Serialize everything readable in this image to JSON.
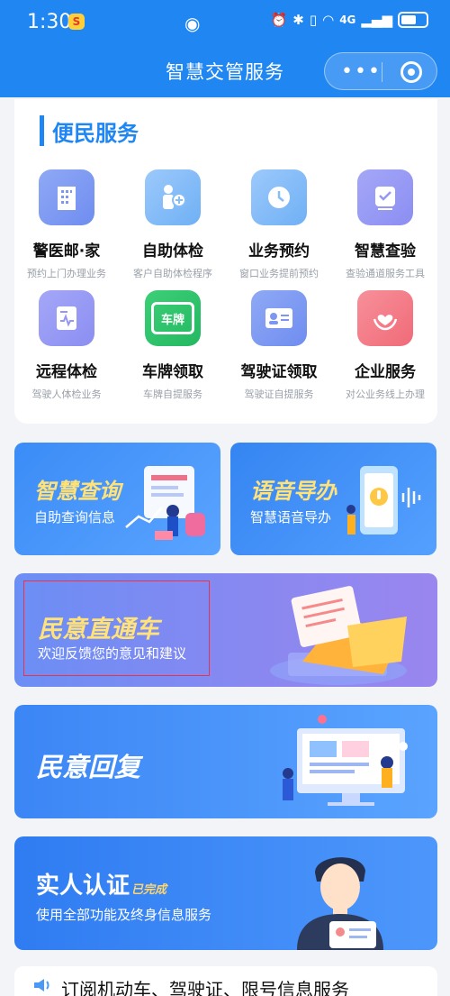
{
  "status_bar": {
    "time": "1:30",
    "app_badge": "S",
    "network": "4G"
  },
  "header": {
    "title": "智慧交管服务",
    "menu_label": "•••"
  },
  "section": {
    "title": "便民服务"
  },
  "services": [
    {
      "name": "警医邮·家",
      "sub": "预约上门办理业务",
      "icon": "building-icon"
    },
    {
      "name": "自助体检",
      "sub": "客户自助体检程序",
      "icon": "person-plus-icon"
    },
    {
      "name": "业务预约",
      "sub": "窗口业务提前预约",
      "icon": "clock-icon"
    },
    {
      "name": "智慧查验",
      "sub": "查验通道服务工具",
      "icon": "checklist-icon"
    },
    {
      "name": "远程体检",
      "sub": "驾驶人体检业务",
      "icon": "health-report-icon"
    },
    {
      "name": "车牌领取",
      "sub": "车牌自提服务",
      "icon": "license-plate-icon",
      "plate_text": "车牌"
    },
    {
      "name": "驾驶证领取",
      "sub": "驾驶证自提服务",
      "icon": "id-card-icon"
    },
    {
      "name": "企业服务",
      "sub": "对公业务线上办理",
      "icon": "heart-hands-icon"
    }
  ],
  "banners": {
    "query": {
      "title": "智慧查询",
      "sub": "自助查询信息"
    },
    "voice": {
      "title": "语音导办",
      "sub": "智慧语音导办"
    },
    "feedback": {
      "title": "民意直通车",
      "sub": "欢迎反馈您的意见和建议"
    },
    "reply": {
      "title": "民意回复"
    },
    "realname": {
      "title": "实人认证",
      "status": "已完成",
      "sub": "使用全部功能及终身信息服务"
    }
  },
  "subscribe": {
    "text": "订阅机动车、驾驶证、限号信息服务"
  },
  "colors": {
    "primary": "#1f86f2",
    "feedback_outline": "#e8334a"
  }
}
